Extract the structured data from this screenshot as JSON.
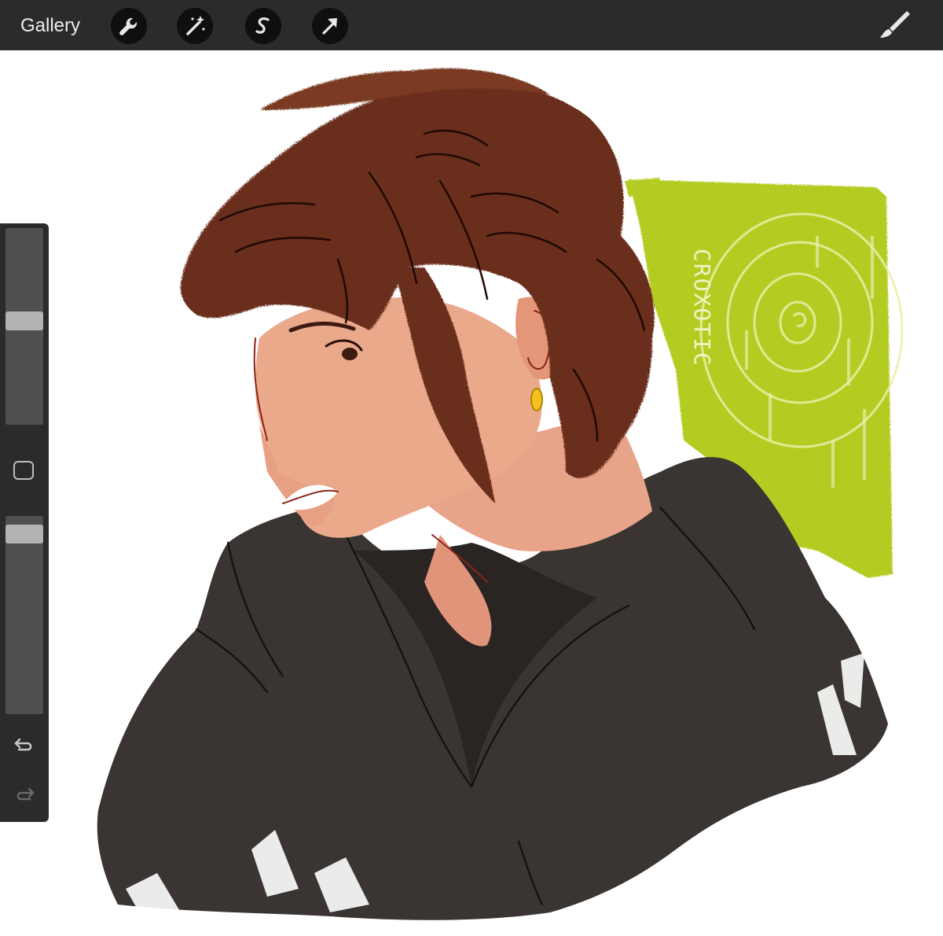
{
  "toolbar": {
    "gallery_label": "Gallery",
    "tools": [
      {
        "name": "actions",
        "icon": "wrench-icon"
      },
      {
        "name": "adjustments",
        "icon": "magic-wand-icon"
      },
      {
        "name": "selection",
        "icon": "selection-s-icon"
      },
      {
        "name": "transform",
        "icon": "arrow-cursor-icon"
      }
    ],
    "brush_icon": "brush-icon"
  },
  "sidebar": {
    "brush_size_level": 0.53,
    "opacity_level": 0.95,
    "modify_icon": "square-icon",
    "undo_icon": "undo-icon",
    "redo_icon": "redo-icon"
  },
  "artwork": {
    "signature": "CROXOTIC",
    "colors": {
      "hair": "#6b2f1c",
      "skin": "#e9a88a",
      "hoodie": "#3a3432",
      "background_block": "#b4cc21",
      "ui_bar": "#2b2b2b"
    }
  }
}
